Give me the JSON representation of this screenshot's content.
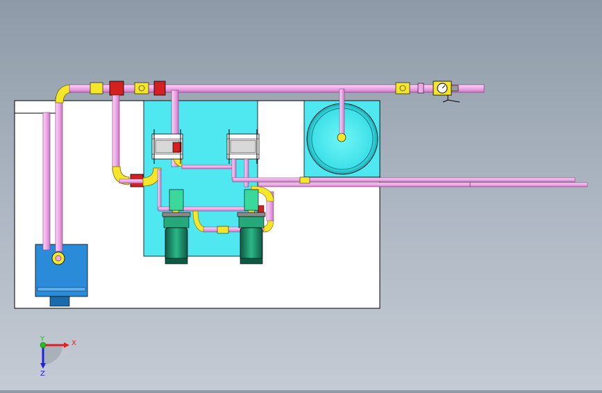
{
  "viewport": {
    "background_top": "#8e9aa8",
    "background_bottom": "#c4cbd4"
  },
  "colors": {
    "pipe": "#f0a8e8",
    "pipe_edge": "#7a3a78",
    "fitting": "#f5e62a",
    "valve": "#d42020",
    "tank_cyan": "#4fe8f0",
    "sump_blue": "#2a8cd8",
    "motor": "#1a8a6a",
    "motor_top": "#3ad89a",
    "frame": "#ffffff",
    "outline": "#000000"
  },
  "model": {
    "parts": [
      "main-pipe",
      "frame",
      "pump-tank",
      "water-tank",
      "sump-tank",
      "pump-motor-left",
      "pump-motor-right",
      "filter-left",
      "filter-right",
      "pressure-gauge",
      "outlet-pipe"
    ]
  },
  "triad": {
    "x_label": "X",
    "y_label": "Y",
    "z_label": "Z",
    "x_color": "#e02020",
    "y_color": "#20c020",
    "z_color": "#2020e0"
  }
}
